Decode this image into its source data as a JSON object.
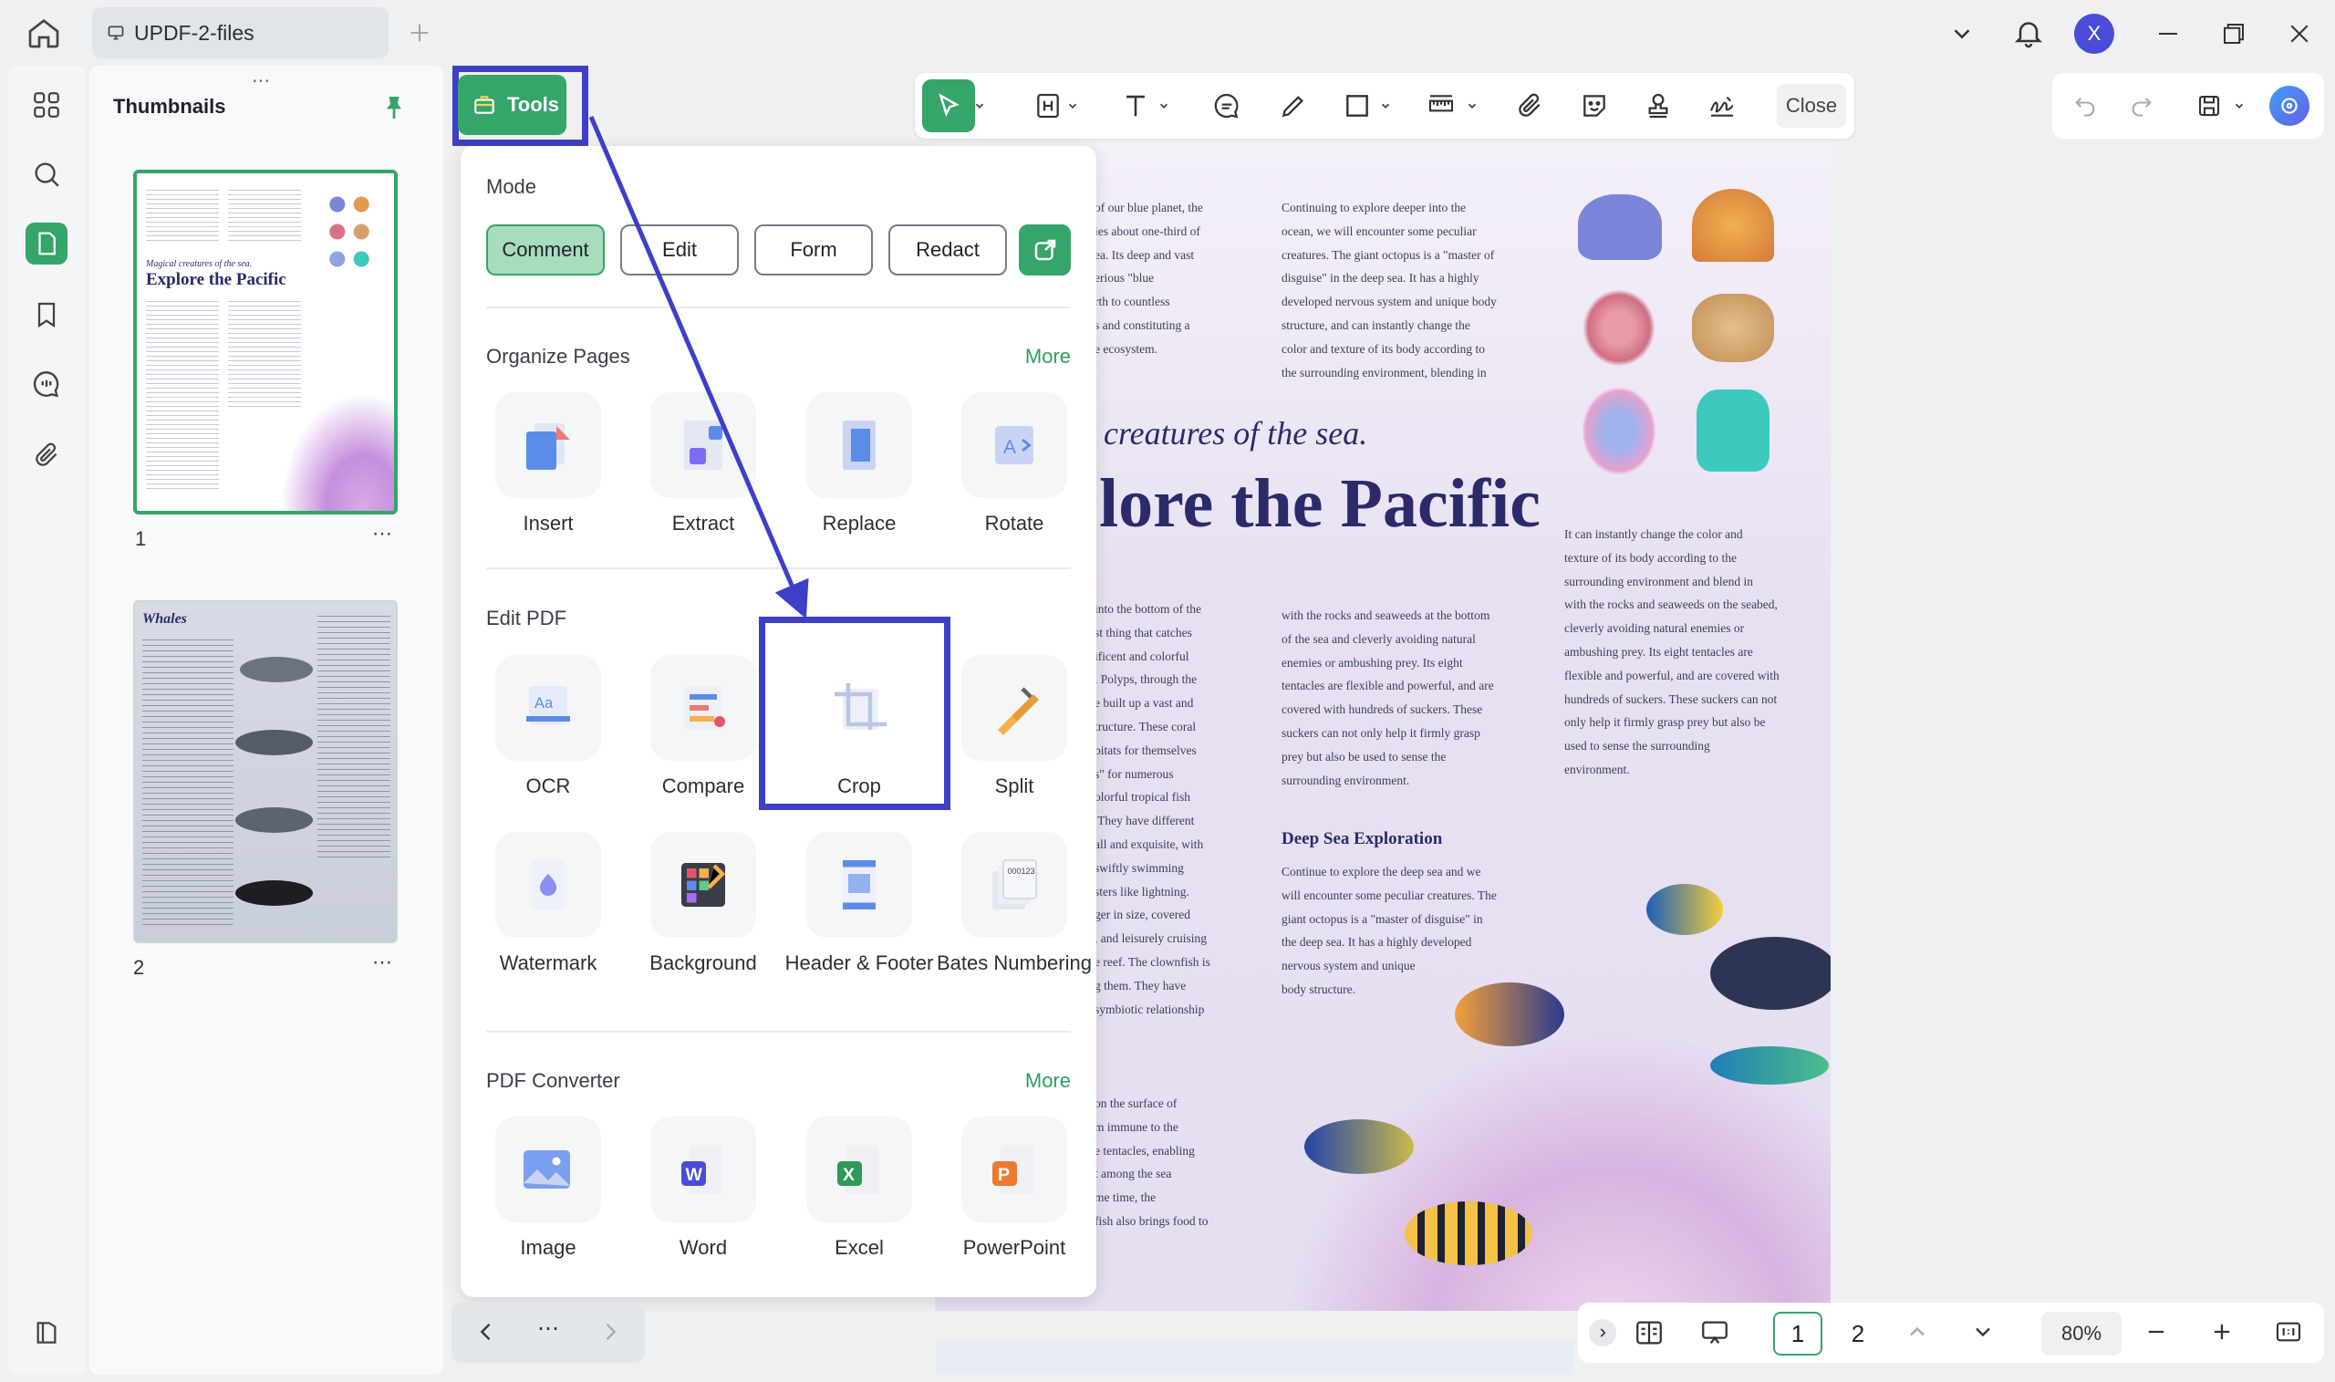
{
  "window": {
    "tab_title": "UPDF-2-files",
    "avatar_letter": "X"
  },
  "thumbnails": {
    "title": "Thumbnails",
    "pages": [
      {
        "number": "1"
      },
      {
        "number": "2"
      }
    ]
  },
  "toolbar": {
    "close_label": "Close"
  },
  "tools_button": {
    "label": "Tools"
  },
  "panel": {
    "mode": {
      "title": "Mode",
      "buttons": [
        "Comment",
        "Edit",
        "Form",
        "Redact"
      ],
      "active": "Comment"
    },
    "organize": {
      "title": "Organize Pages",
      "more": "More",
      "items": [
        "Insert",
        "Extract",
        "Replace",
        "Rotate"
      ]
    },
    "edit": {
      "title": "Edit PDF",
      "items": [
        "OCR",
        "Compare",
        "Crop",
        "Split",
        "Watermark",
        "Background",
        "Header & Footer",
        "Bates Numbering"
      ]
    },
    "converter": {
      "title": "PDF Converter",
      "more": "More",
      "items": [
        "Image",
        "Word",
        "Excel",
        "PowerPoint"
      ]
    }
  },
  "document": {
    "subtitle": "creatures of the sea.",
    "title": "lore the Pacific",
    "col1_top": "of our blue planet, the\nies about one-third of\nea. Its deep and vast\nerious \"blue\nrth to countless\ns and constituting a\ne ecosystem.",
    "col2_top": "Continuing to explore deeper into the\nocean, we will encounter some peculiar\ncreatures. The giant octopus is a \"master of\ndisguise\" in the deep sea. It has a highly\ndeveloped nervous system and unique body\nstructure, and can instantly change the\ncolor and texture of its body according to\nthe surrounding environment, blending in",
    "col1_mid": "into the bottom of the\nst thing that catches\nificent and colorful\n. Polyps, through the\ne built up a vast and\ntructure. These coral\nbitats for themselves\ns\" for numerous\nolorful tropical fish\n They have different\nall and exquisite, with\nswiftly swimming\nsters like lightning.\nger in size, covered\n, and leisurely cruising\ne reef. The clownfish is\ng them. They have\nsymbiotic relationship",
    "col2_mid": "with the rocks and seaweeds at the bottom\nof the sea and cleverly avoiding natural\nenemies or ambushing prey. Its eight\ntentacles are flexible and powerful, and are\ncovered with hundreds of suckers. These\nsuckers can not only help it firmly grasp\nprey but also be used to sense the\nsurrounding environment.",
    "col3_mid": "It can instantly change the color and\ntexture of its body according to the\nsurrounding environment and blend in\nwith the rocks and seaweeds on the seabed,\ncleverly avoiding natural enemies or\nambushing prey. Its eight tentacles are\nflexible and powerful, and are covered with\nhundreds of suckers. These suckers can not\nonly help it firmly grasp prey but also be\nused to sense the surrounding\nenvironment.",
    "deep_sea_heading": "Deep Sea Exploration",
    "col2_deep": "Continue to explore the deep sea and we\nwill encounter some peculiar creatures. The\ngiant octopus is a \"master of disguise\" in\nthe deep sea. It has a highly developed\nnervous system and unique\nbody structure.",
    "col1_bottom": "on the surface of\nm immune to the\ne tentacles, enabling\nt among the sea\nme time, the\nfish also brings food to"
  },
  "bottom": {
    "page1": "1",
    "page2": "2",
    "zoom": "80%"
  },
  "colors": {
    "accent_green": "#35a56a",
    "highlight_blue": "#3d3fc7",
    "title_navy": "#2b2a6b"
  }
}
